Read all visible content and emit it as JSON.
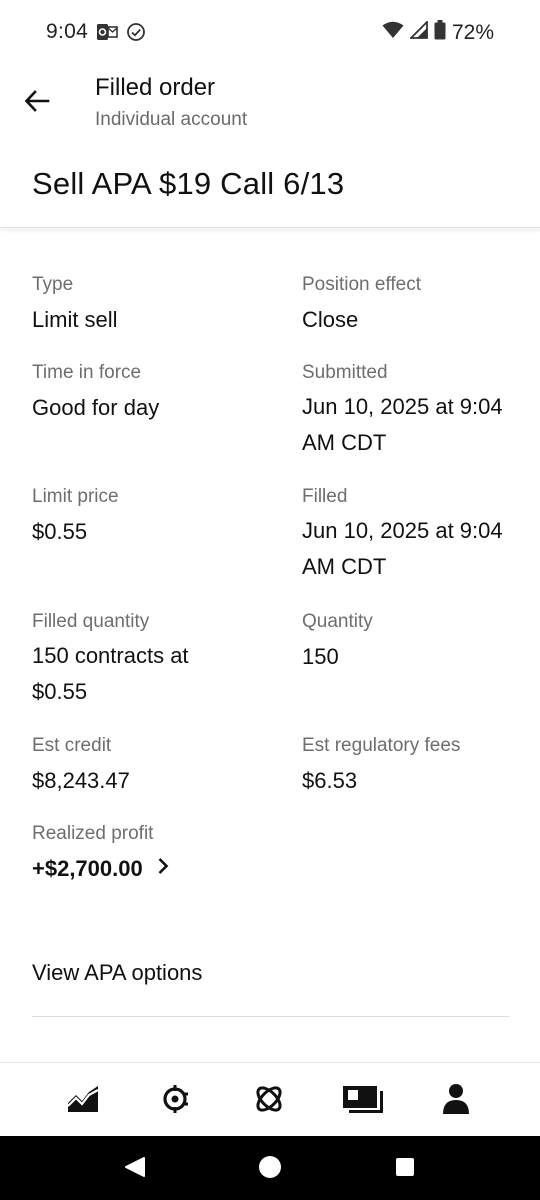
{
  "status_bar": {
    "time": "9:04",
    "battery": "72%",
    "icons": [
      "outlook-icon",
      "check-circle-icon",
      "wifi-icon",
      "signal-icon",
      "battery-icon"
    ]
  },
  "header": {
    "title": "Filled order",
    "subtitle": "Individual account",
    "order_title": "Sell APA $19 Call 6/13",
    "back_icon": "arrow-left-icon"
  },
  "details": {
    "type": {
      "label": "Type",
      "value": "Limit sell"
    },
    "position_effect": {
      "label": "Position effect",
      "value": "Close"
    },
    "time_in_force": {
      "label": "Time in force",
      "value": "Good for day"
    },
    "submitted": {
      "label": "Submitted",
      "value_line1": "Jun 10, 2025 at 9:04",
      "value_line2": "AM CDT"
    },
    "limit_price": {
      "label": "Limit price",
      "value": "$0.55"
    },
    "filled": {
      "label": "Filled",
      "value_line1": "Jun 10, 2025 at 9:04",
      "value_line2": "AM CDT"
    },
    "filled_quantity": {
      "label": "Filled quantity",
      "value_line1": "150 contracts at",
      "value_line2": "$0.55"
    },
    "quantity": {
      "label": "Quantity",
      "value": "150"
    },
    "est_credit": {
      "label": "Est credit",
      "value": "$8,243.47"
    },
    "est_regulatory_fees": {
      "label": "Est regulatory fees",
      "value": "$6.53"
    },
    "realized_profit": {
      "label": "Realized profit",
      "value": "+$2,700.00"
    }
  },
  "links": {
    "view_options": "View APA options"
  },
  "bottom_nav": {
    "items": [
      "chart-icon",
      "crypto-icon",
      "discover-icon",
      "cash-card-icon",
      "account-icon"
    ]
  },
  "android_nav": {
    "items": [
      "back-triangle-icon",
      "home-circle-icon",
      "recents-square-icon"
    ]
  },
  "colors": {
    "text_primary": "#111111",
    "text_secondary": "#6e6e6e",
    "divider": "#dedede"
  }
}
